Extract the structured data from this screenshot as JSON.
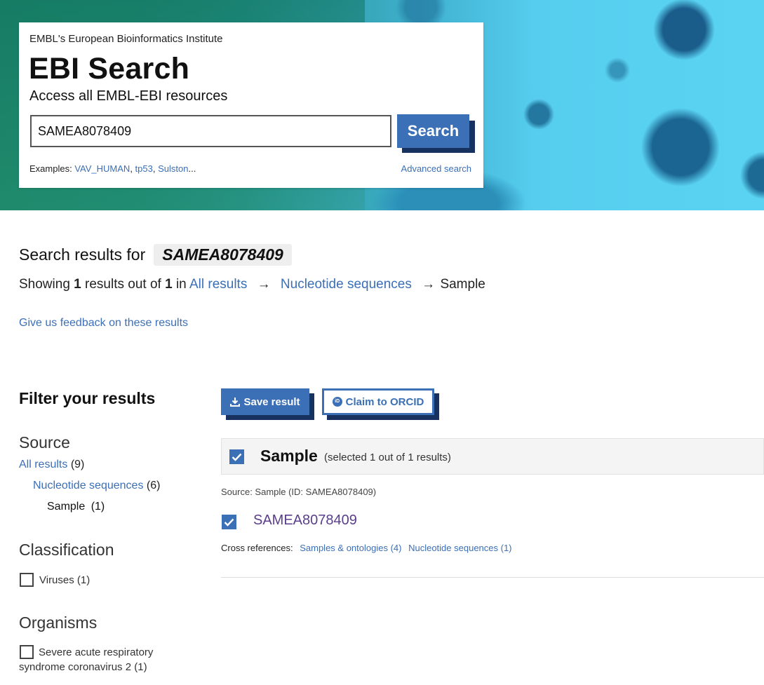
{
  "header": {
    "org": "EMBL's European Bioinformatics Institute",
    "title": "EBI Search",
    "subtitle": "Access all EMBL-EBI resources",
    "search_value": "SAMEA8078409",
    "search_button": "Search",
    "examples_label": "Examples:",
    "examples": [
      "VAV_HUMAN",
      "tp53",
      "Sulston"
    ],
    "examples_ellipsis": "...",
    "advanced_search": "Advanced search"
  },
  "results": {
    "heading": "Search results for",
    "query": "SAMEA8078409",
    "showing_prefix": "Showing",
    "count": "1",
    "results_out_of": "results out of",
    "total": "1",
    "in_label": "in",
    "breadcrumb": [
      "All results",
      "Nucleotide sequences",
      "Sample"
    ],
    "arrow": "→",
    "feedback": "Give us feedback on these results"
  },
  "sidebar": {
    "filter_title": "Filter your results",
    "source_title": "Source",
    "all_results": {
      "label": "All results",
      "count": "(9)"
    },
    "nucleotide": {
      "label": "Nucleotide sequences",
      "count": "(6)"
    },
    "sample": {
      "label": "Sample",
      "count": "(1)"
    },
    "classification_title": "Classification",
    "classification_options": [
      {
        "label": "Viruses (1)",
        "checked": false
      }
    ],
    "organisms_title": "Organisms",
    "organism_options": [
      {
        "label": "Severe acute respiratory syndrome coronavirus 2 (1)",
        "checked": false
      }
    ]
  },
  "actions": {
    "save": "Save result",
    "orcid": "Claim to ORCID",
    "orcid_icon_text": "iD"
  },
  "result_group": {
    "title": "Sample",
    "selection": "(selected 1 out of 1 results)",
    "source_line": "Source: Sample (ID: SAMEA8078409)",
    "item_id": "SAMEA8078409",
    "xrefs_label": "Cross references:",
    "xrefs": [
      "Samples & ontologies (4)",
      "Nucleotide sequences (1)"
    ]
  },
  "colors": {
    "link": "#3b6fb6",
    "button": "#3b6fb6",
    "button_shadow": "#17325e",
    "visited": "#5a3e8c"
  }
}
